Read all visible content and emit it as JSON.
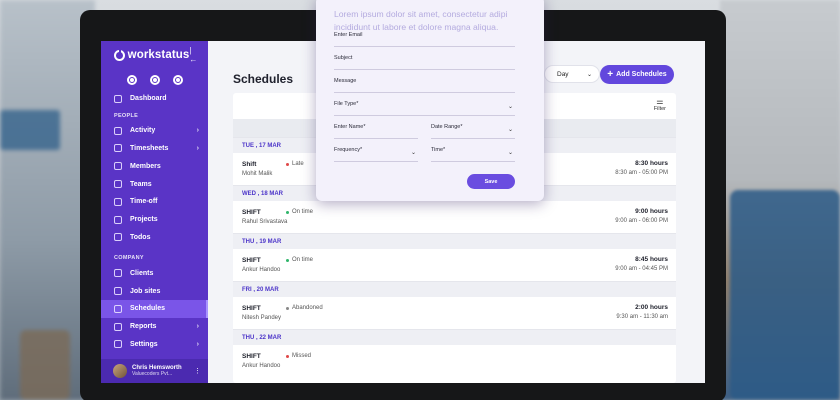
{
  "app": {
    "brand": "workstatus"
  },
  "sidebar": {
    "main_items": [
      {
        "label": "Dashboard"
      }
    ],
    "people_section": "PEOPLE",
    "people_items": [
      {
        "label": "Activity",
        "chevron": true
      },
      {
        "label": "Timesheets",
        "chevron": true
      },
      {
        "label": "Members",
        "chevron": false
      },
      {
        "label": "Teams",
        "chevron": false
      },
      {
        "label": "Time-off",
        "chevron": false
      },
      {
        "label": "Projects",
        "chevron": false
      },
      {
        "label": "Todos",
        "chevron": false
      }
    ],
    "company_section": "COMPANY",
    "company_items": [
      {
        "label": "Clients",
        "chevron": false
      },
      {
        "label": "Job sites",
        "chevron": false
      },
      {
        "label": "Schedules",
        "chevron": false,
        "active": true
      },
      {
        "label": "Reports",
        "chevron": true
      },
      {
        "label": "Settings",
        "chevron": true
      }
    ],
    "user": {
      "name": "Chris Hemsworth",
      "org": "Valuecoders Pvt..."
    }
  },
  "header": {
    "title": "Schedules",
    "day_select": "Day",
    "add_button": "Add Schedules",
    "filter_label": "Filter"
  },
  "schedules": [
    {
      "date": "TUE , 17 MAR",
      "shift": "Shift",
      "employee": "Mohit Malik",
      "status": "Late",
      "status_color": "#e04848",
      "hours": "8:30 hours",
      "time": "8:30 am - 05:00 PM"
    },
    {
      "date": "WED , 18 MAR",
      "shift": "SHIFT",
      "employee": "Rahul Srivastava",
      "status": "On time",
      "status_color": "#2fb56a",
      "hours": "9:00 hours",
      "time": "9:00 am - 06:00 PM"
    },
    {
      "date": "THU , 19 MAR",
      "shift": "SHIFT",
      "employee": "Ankur Handoo",
      "status": "On time",
      "status_color": "#2fb56a",
      "hours": "8:45 hours",
      "time": "9:00 am - 04:45 PM"
    },
    {
      "date": "FRI , 20 MAR",
      "shift": "SHIFT",
      "employee": "Nitesh Pandey",
      "status": "Abandoned",
      "status_color": "#888888",
      "hours": "2:00 hours",
      "time": "9:30 am - 11:30 am"
    },
    {
      "date": "THU , 22 MAR",
      "shift": "SHIFT",
      "employee": "Ankur Handoo",
      "status": "Missed",
      "status_color": "#e04848",
      "hours": "",
      "time": ""
    }
  ],
  "modal": {
    "lorem": "Lorem ipsum dolor sit amet, consectetur adipi incididunt ut labore et dolore magna aliqua.",
    "email_label": "Enter Email",
    "subject_label": "Subject",
    "message_label": "Message",
    "file_type_label": "File Type*",
    "name_label": "Enter Name*",
    "date_range_label": "Date Range*",
    "frequency_label": "Frequency*",
    "time_label": "Time*",
    "save_label": "Save"
  },
  "colors": {
    "sidebar": "#5a34c6",
    "accent": "#6247dd",
    "date_text": "#4c35c9"
  }
}
